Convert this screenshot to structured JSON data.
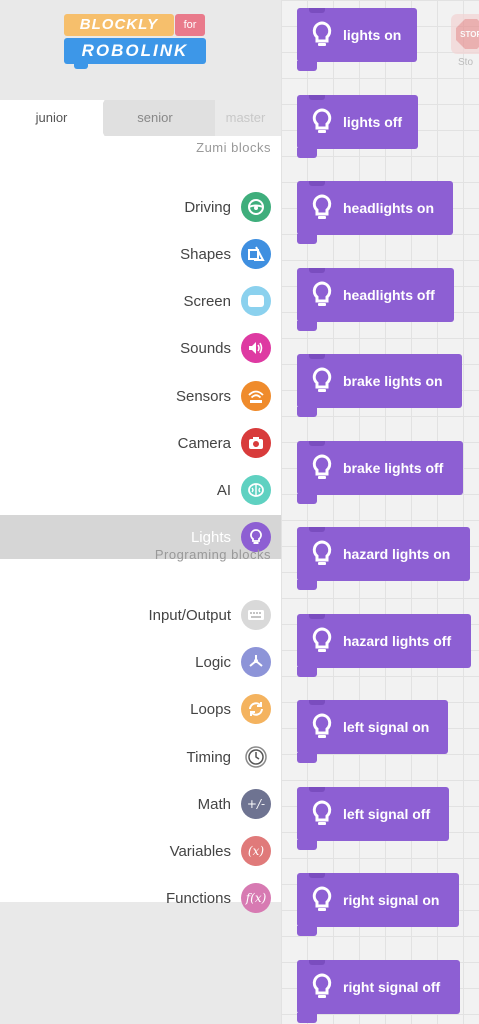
{
  "logo": {
    "top_text": "BLOCKLY",
    "for_text": "for",
    "bottom_text": "ROBOLINK"
  },
  "tabs": [
    {
      "label": "junior"
    },
    {
      "label": "senior"
    },
    {
      "label": "master"
    }
  ],
  "sections": {
    "zumi": "Zumi blocks",
    "programming": "Programing blocks"
  },
  "categories": [
    {
      "label": "Driving",
      "color": "#3fae7c",
      "icon": "steering-wheel-icon"
    },
    {
      "label": "Shapes",
      "color": "#3f8fe0",
      "icon": "shapes-icon"
    },
    {
      "label": "Screen",
      "color": "#8bd1ee",
      "icon": "screen-icon"
    },
    {
      "label": "Sounds",
      "color": "#de3aa2",
      "icon": "speaker-icon"
    },
    {
      "label": "Sensors",
      "color": "#ef8b2c",
      "icon": "sensor-icon"
    },
    {
      "label": "Camera",
      "color": "#d83b3b",
      "icon": "camera-icon"
    },
    {
      "label": "AI",
      "color": "#5fd1c1",
      "icon": "brain-icon"
    },
    {
      "label": "Lights",
      "color": "#8d5fd3",
      "icon": "lightbulb-icon"
    },
    {
      "label": "Input/Output",
      "color": "#d9d9d9",
      "icon": "keyboard-icon"
    },
    {
      "label": "Logic",
      "color": "#8d94d8",
      "icon": "logic-icon"
    },
    {
      "label": "Loops",
      "color": "#f4b35f",
      "icon": "loop-icon"
    },
    {
      "label": "Timing",
      "color": "#ffffff",
      "icon": "clock-icon"
    },
    {
      "label": "Math",
      "color": "#6e7391",
      "icon": "math-icon",
      "glyph": "+/-"
    },
    {
      "label": "Variables",
      "color": "#e07a7a",
      "icon": "variables-icon",
      "glyph": "(x)"
    },
    {
      "label": "Functions",
      "color": "#d77ab2",
      "icon": "functions-icon",
      "glyph": "f(x)"
    }
  ],
  "blocks": [
    "lights on",
    "lights off",
    "headlights on",
    "headlights off",
    "brake lights on",
    "brake lights off",
    "hazard lights on",
    "hazard lights off",
    "left signal on",
    "left signal off",
    "right signal on",
    "right signal off"
  ],
  "workspace": {
    "stop_label": "Sto",
    "stop_sign_text": "STOP"
  },
  "colors": {
    "block": "#8d5fd3",
    "selected_row": "#d6d6d6"
  }
}
